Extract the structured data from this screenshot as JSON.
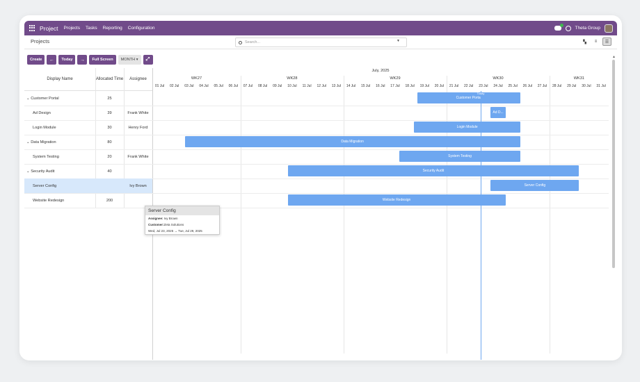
{
  "topbar": {
    "brand": "Project",
    "menu": [
      "Projects",
      "Tasks",
      "Reporting",
      "Configuration"
    ],
    "company": "Theta Group"
  },
  "breadcrumb": "Projects",
  "search": {
    "placeholder": "Search..."
  },
  "toolbar": {
    "create": "Create",
    "today": "Today",
    "fullscreen": "Full Screen",
    "scale": "MONTH"
  },
  "columns": {
    "name": "Display Name",
    "allocated": "Allocated Time",
    "assignee": "Assignee"
  },
  "timeline": {
    "month": "July, 2025",
    "weeks": [
      "WK27",
      "WK28",
      "WK29",
      "WK30",
      "WK31"
    ],
    "days": [
      "01 Jul",
      "02 Jul",
      "03 Jul",
      "04 Jul",
      "05 Jul",
      "06 Jul",
      "07 Jul",
      "08 Jul",
      "09 Jul",
      "10 Jul",
      "11 Jul",
      "12 Jul",
      "13 Jul",
      "14 Jul",
      "15 Jul",
      "16 Jul",
      "17 Jul",
      "18 Jul",
      "19 Jul",
      "20 Jul",
      "21 Jul",
      "22 Jul",
      "23 Jul",
      "24 Jul",
      "25 Jul",
      "26 Jul",
      "27 Jul",
      "28 Jul",
      "29 Jul",
      "30 Jul",
      "31 Jul"
    ],
    "today_label": "Today"
  },
  "rows": [
    {
      "name": "Customer Portal",
      "group": true,
      "allocated": "25",
      "assignee": "",
      "bar": {
        "label": "Customer Portal",
        "start": 18,
        "end": 25
      }
    },
    {
      "name": "Ad Design",
      "group": false,
      "allocated": "39",
      "assignee": "Frank White",
      "bar": {
        "label": "Ad D...",
        "start": 23,
        "end": 24
      }
    },
    {
      "name": "Login Module",
      "group": false,
      "allocated": "30",
      "assignee": "Henry Ford",
      "bar": {
        "label": "Login Module",
        "start": 17.8,
        "end": 25
      }
    },
    {
      "name": "Data Migration",
      "group": true,
      "allocated": "80",
      "assignee": "",
      "bar": {
        "label": "Data Migration",
        "start": 2.2,
        "end": 25
      }
    },
    {
      "name": "System Testing",
      "group": false,
      "allocated": "20",
      "assignee": "Frank White",
      "bar": {
        "label": "System Testing",
        "start": 16.8,
        "end": 25
      }
    },
    {
      "name": "Security Audit",
      "group": true,
      "allocated": "40",
      "assignee": "",
      "bar": {
        "label": "Security Audit",
        "start": 9.2,
        "end": 29
      }
    },
    {
      "name": "Server Config",
      "group": false,
      "allocated": "",
      "assignee": "Ivy Brown",
      "bar": {
        "label": "Server Config",
        "start": 23,
        "end": 29
      },
      "selected": true
    },
    {
      "name": "Website Redesign",
      "group": false,
      "allocated": "200",
      "assignee": "",
      "bar": {
        "label": "Website Redesign",
        "start": 9.2,
        "end": 24
      }
    }
  ],
  "tooltip": {
    "title": "Server Config",
    "assignee_label": "Assignee:",
    "assignee": "Ivy Brown",
    "customer_label": "Customer:",
    "customer": "Zeta Solutions",
    "dates": "Wed, Jul 23, 2025 → Tue, Jul 29, 2025"
  },
  "colors": {
    "brand": "#714b8a",
    "bar": "#6ea7f0",
    "selected_row": "#d7e8fb"
  }
}
